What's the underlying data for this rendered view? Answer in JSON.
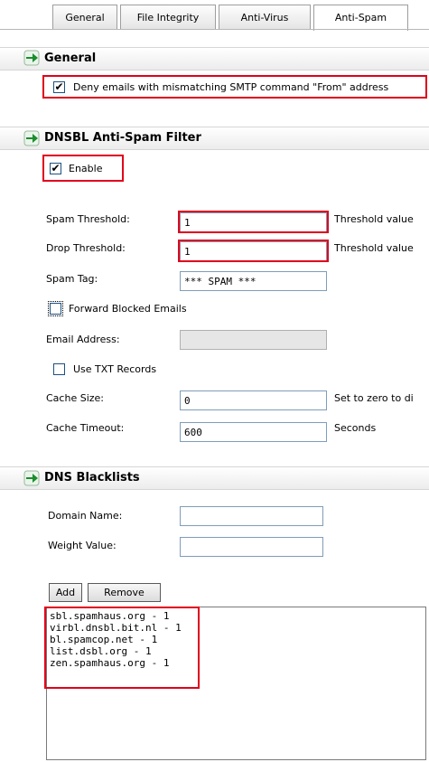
{
  "tabs": [
    "General",
    "File Integrity",
    "Anti-Virus",
    "Anti-Spam"
  ],
  "active_tab": "Anti-Spam",
  "general": {
    "title": "General",
    "deny_label": "Deny emails with mismatching SMTP command \"From\" address",
    "deny_checked": true
  },
  "dnsbl": {
    "title": "DNSBL Anti-Spam Filter",
    "enable_label": "Enable",
    "enable_checked": true,
    "spam_threshold_label": "Spam Threshold:",
    "spam_threshold_value": "1",
    "spam_threshold_hint": "Threshold value",
    "drop_threshold_label": "Drop Threshold:",
    "drop_threshold_value": "1",
    "drop_threshold_hint": "Threshold value",
    "spam_tag_label": "Spam Tag:",
    "spam_tag_value": "*** SPAM ***",
    "forward_label": "Forward Blocked Emails",
    "forward_checked": false,
    "email_label": "Email Address:",
    "email_value": "",
    "txt_label": "Use TXT Records",
    "txt_checked": false,
    "cache_size_label": "Cache Size:",
    "cache_size_value": "0",
    "cache_size_hint": "Set to zero to di",
    "cache_timeout_label": "Cache Timeout:",
    "cache_timeout_value": "600",
    "cache_timeout_hint": "Seconds"
  },
  "blacklists": {
    "title": "DNS Blacklists",
    "domain_label": "Domain Name:",
    "domain_value": "",
    "weight_label": "Weight Value:",
    "weight_value": "",
    "add_label": "Add",
    "remove_label": "Remove",
    "items": [
      "sbl.spamhaus.org - 1",
      "virbl.dnsbl.bit.nl - 1",
      "bl.spamcop.net - 1",
      "list.dsbl.org - 1",
      "zen.spamhaus.org - 1"
    ]
  },
  "colors": {
    "highlight": "#e0001b",
    "arrow": "#1b8d2e"
  }
}
